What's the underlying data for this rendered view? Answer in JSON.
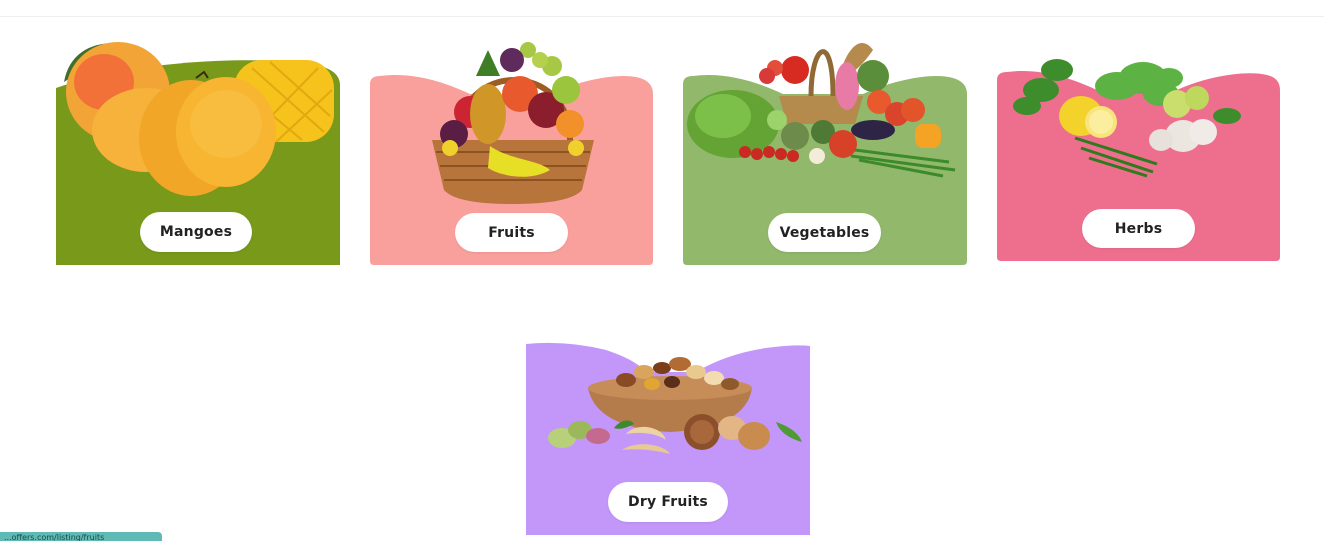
{
  "categories": [
    {
      "label": "Mangoes",
      "color": "#78991a",
      "icon": "mango-icon"
    },
    {
      "label": "Fruits",
      "color": "#f9a09c",
      "icon": "fruit-basket-icon"
    },
    {
      "label": "Vegetables",
      "color": "#91b86b",
      "icon": "vegetable-basket-icon"
    },
    {
      "label": "Herbs",
      "color": "#ee6f8d",
      "icon": "herbs-icon"
    },
    {
      "label": "Dry Fruits",
      "color": "#c397fa",
      "icon": "dry-fruits-bowl-icon"
    }
  ],
  "status_bar": {
    "url": "...offers.com/listing/fruits"
  }
}
